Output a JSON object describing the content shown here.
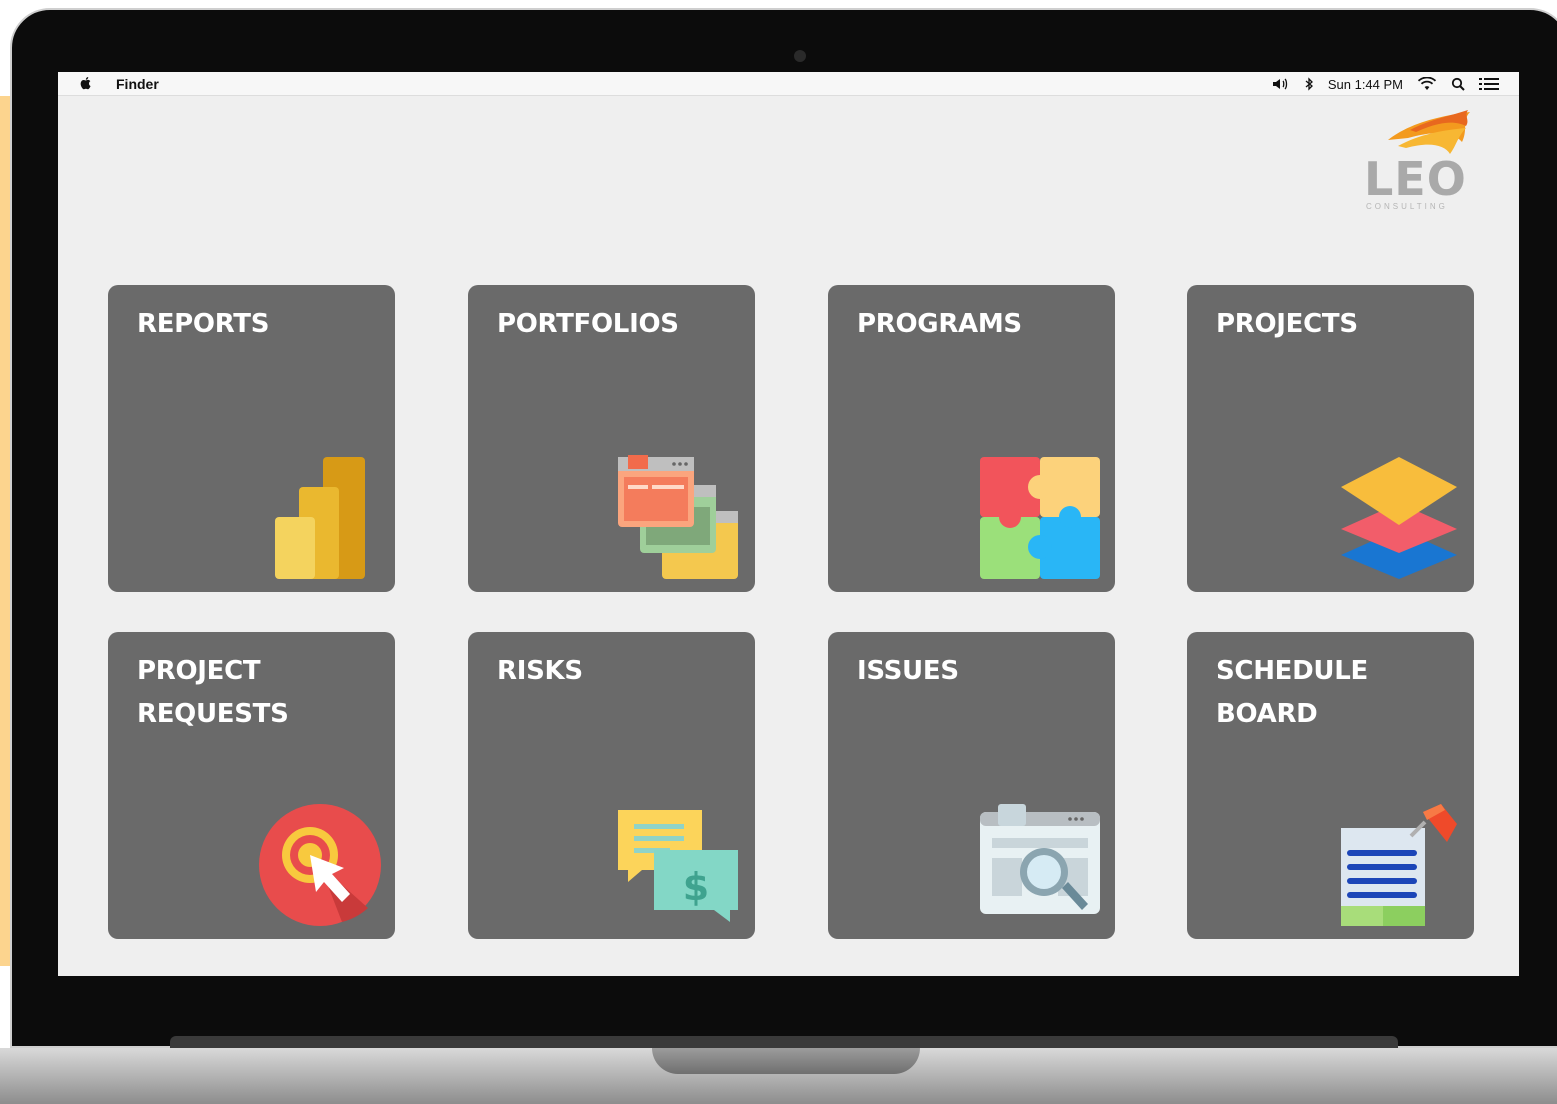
{
  "menubar": {
    "app_name": "Finder",
    "clock": "Sun 1:44 PM",
    "icons": [
      "apple-icon",
      "volume-icon",
      "bluetooth-icon",
      "wifi-icon",
      "search-icon",
      "list-icon"
    ]
  },
  "logo": {
    "text": "LEO",
    "subtext": "CONSULTING"
  },
  "tiles": [
    {
      "label": "REPORTS",
      "icon": "bar-chart-icon"
    },
    {
      "label": "PORTFOLIOS",
      "icon": "windows-stack-icon"
    },
    {
      "label": "PROGRAMS",
      "icon": "puzzle-icon"
    },
    {
      "label": "PROJECTS",
      "icon": "layers-icon"
    },
    {
      "label": "PROJECT\nREQUESTS",
      "icon": "target-cursor-icon"
    },
    {
      "label": "RISKS",
      "icon": "chat-dollar-icon"
    },
    {
      "label": "ISSUES",
      "icon": "browser-search-icon"
    },
    {
      "label": "SCHEDULE\nBOARD",
      "icon": "document-pin-icon"
    }
  ],
  "colors": {
    "tile_bg": "#6a6a6a",
    "screen_bg": "#efefef",
    "logo_orange": "#f39a1e"
  }
}
